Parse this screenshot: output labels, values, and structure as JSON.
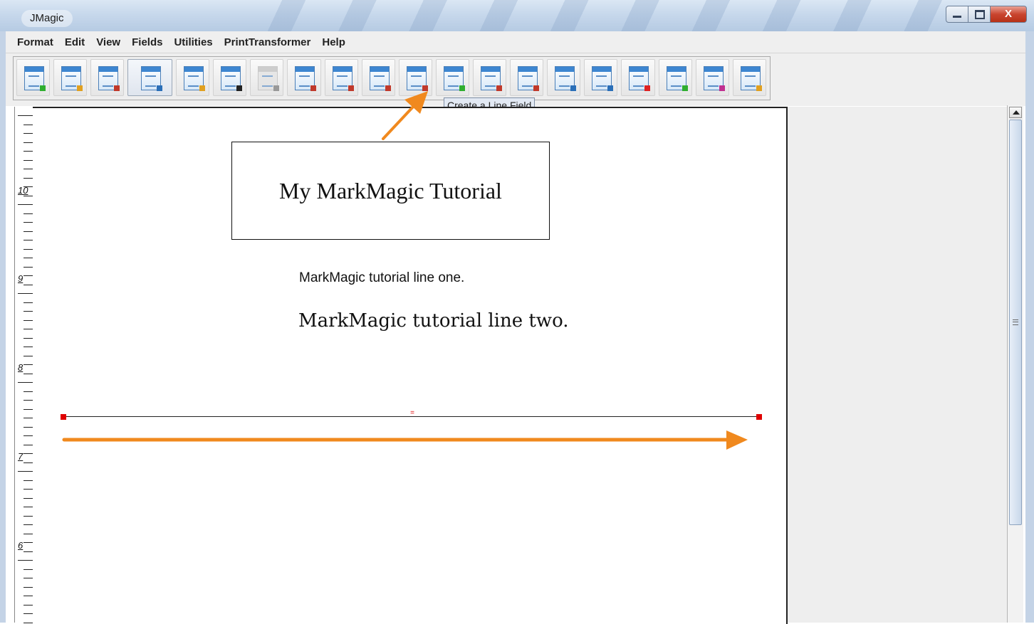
{
  "window": {
    "title": "JMagic",
    "controls": [
      "minimize",
      "maximize",
      "close"
    ],
    "close_glyph": "X"
  },
  "menu": [
    "Format",
    "Edit",
    "View",
    "Fields",
    "Utilities",
    "PrintTransformer",
    "Help"
  ],
  "toolbar": {
    "tooltip": "Create a Line Field",
    "buttons": [
      {
        "name": "new-format-icon"
      },
      {
        "name": "open-format-icon"
      },
      {
        "name": "save-format-icon"
      },
      {
        "name": "print-icon",
        "active": true
      },
      {
        "name": "data-source-icon"
      },
      {
        "name": "barcode-field-icon"
      },
      {
        "name": "copy-field-icon",
        "disabled": true
      },
      {
        "name": "text-field-icon"
      },
      {
        "name": "multi-line-text-icon"
      },
      {
        "name": "box-field-icon"
      },
      {
        "name": "line-field-icon"
      },
      {
        "name": "image-field-icon"
      },
      {
        "name": "field-list-icon"
      },
      {
        "name": "field-properties-icon"
      },
      {
        "name": "field-order-icon"
      },
      {
        "name": "grid-icon"
      },
      {
        "name": "delete-field-icon"
      },
      {
        "name": "select-field-icon"
      },
      {
        "name": "undo-icon"
      },
      {
        "name": "redo-icon"
      }
    ]
  },
  "ruler": {
    "labels": [
      "10",
      "9",
      "8",
      "7",
      "6"
    ]
  },
  "canvas": {
    "title_box_text": "My MarkMagic Tutorial",
    "line_one": "MarkMagic tutorial line one.",
    "line_two": "MarkMagic tutorial line two.",
    "line_field_mid_glyph": "="
  },
  "colors": {
    "annotation_arrow": "#f0891e",
    "selection_handle": "#e00000"
  }
}
